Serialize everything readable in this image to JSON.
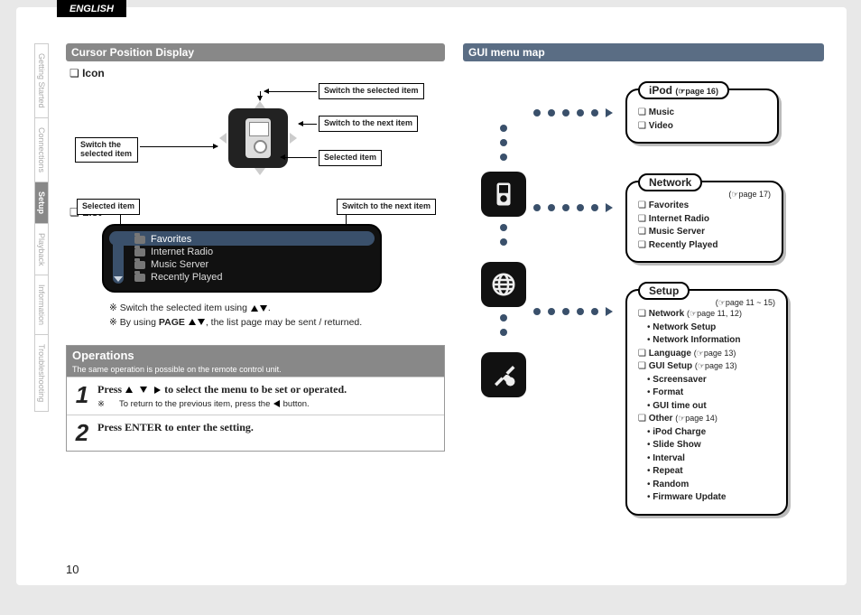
{
  "language_tab": "ENGLISH",
  "page_number": "10",
  "sidenav": [
    {
      "label": "Getting Started",
      "active": false
    },
    {
      "label": "Connections",
      "active": false
    },
    {
      "label": "Setup",
      "active": true
    },
    {
      "label": "Playback",
      "active": false
    },
    {
      "label": "Information",
      "active": false
    },
    {
      "label": "Troubleshooting",
      "active": false
    }
  ],
  "cursor_section": {
    "heading": "Cursor Position Display",
    "icon_sub": "Icon",
    "list_sub": "List",
    "tag_switch_selected_left": "Switch the\nselected item",
    "tag_switch_selected_top": "Switch the selected item",
    "tag_switch_next": "Switch to the next item",
    "tag_selected_item": "Selected item",
    "list_tag_selected": "Selected item",
    "list_tag_next": "Switch to the next item",
    "list_items": [
      "Favorites",
      "Internet Radio",
      "Music Server",
      "Recently Played"
    ],
    "note1_a": "Switch the selected item using ",
    "note1_b": ".",
    "note2_a": "By using ",
    "note2_page": "PAGE",
    "note2_b": ", the list page may be sent / returned."
  },
  "operations": {
    "heading": "Operations",
    "subheading": "The same operation is possible on the remote control unit.",
    "step1_a": "Press ",
    "step1_b": " to select the menu to be set or operated.",
    "step1_hint_a": "To return to the previous item, press the ",
    "step1_hint_b": " button.",
    "step2_a": "Press ",
    "step2_enter": "ENTER",
    "step2_b": " to enter the setting."
  },
  "gui_map": {
    "heading": "GUI menu map",
    "ipod": {
      "title": "iPod",
      "page": "page 16",
      "items": [
        "Music",
        "Video"
      ]
    },
    "network": {
      "title": "Network",
      "page": "page 17",
      "items": [
        "Favorites",
        "Internet Radio",
        "Music Server",
        "Recently Played"
      ]
    },
    "setup": {
      "title": "Setup",
      "page": "page 11 ~ 15",
      "network_label": "Network",
      "network_page": "page 11, 12",
      "network_items": [
        "Network Setup",
        "Network Information"
      ],
      "language_label": "Language",
      "language_page": "page 13",
      "gui_label": "GUI Setup",
      "gui_page": "page 13",
      "gui_items": [
        "Screensaver",
        "Format",
        "GUI time out"
      ],
      "other_label": "Other",
      "other_page": "page 14",
      "other_items": [
        "iPod Charge",
        "Slide Show",
        "Interval",
        "Repeat",
        "Random",
        "Firmware Update"
      ]
    }
  }
}
